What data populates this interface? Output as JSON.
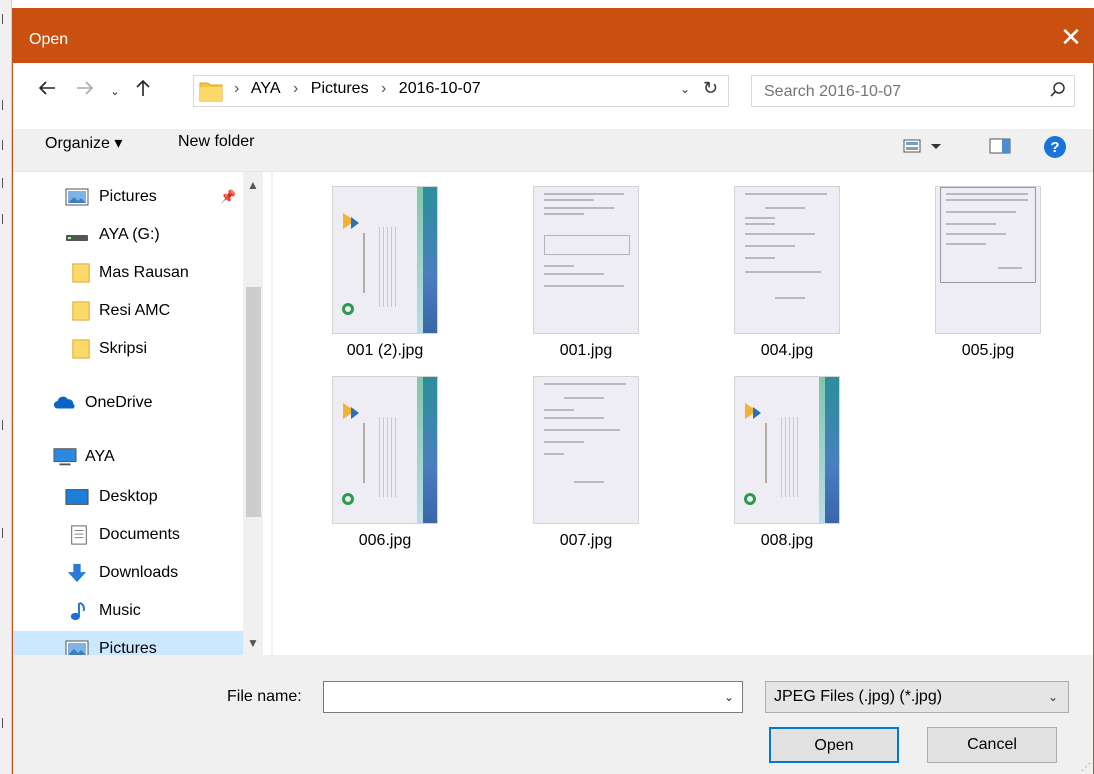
{
  "dialog": {
    "title": "Open",
    "close_glyph": "✕",
    "accent_color": "#c9500f"
  },
  "nav": {
    "back_icon": "back-arrow-icon",
    "forward_icon": "forward-arrow-icon",
    "recent_icon": "chevron-down-icon",
    "up_icon": "up-arrow-icon",
    "breadcrumbs": [
      "AYA",
      "Pictures",
      "2016-10-07"
    ],
    "search_placeholder": "Search 2016-10-07"
  },
  "toolbar": {
    "organize_label": "Organize ▾",
    "new_folder_label": "New folder",
    "help_glyph": "?"
  },
  "sidebar": {
    "items": [
      {
        "label": "Pictures",
        "icon": "pictures-folder-icon",
        "pinned": true
      },
      {
        "label": "AYA (G:)",
        "icon": "drive-icon"
      },
      {
        "label": "Mas Rausan",
        "icon": "folder-icon"
      },
      {
        "label": "Resi AMC",
        "icon": "folder-icon"
      },
      {
        "label": "Skripsi",
        "icon": "folder-icon"
      },
      {
        "label": "OneDrive",
        "icon": "onedrive-cloud-icon"
      },
      {
        "label": "AYA",
        "icon": "computer-icon"
      },
      {
        "label": "Desktop",
        "icon": "desktop-icon"
      },
      {
        "label": "Documents",
        "icon": "documents-icon"
      },
      {
        "label": "Downloads",
        "icon": "downloads-icon"
      },
      {
        "label": "Music",
        "icon": "music-icon"
      },
      {
        "label": "Pictures",
        "icon": "pictures-folder-icon",
        "selected": true
      }
    ]
  },
  "files": [
    {
      "name": "001 (2).jpg",
      "kind": "certificate"
    },
    {
      "name": "001.jpg",
      "kind": "document"
    },
    {
      "name": "004.jpg",
      "kind": "document"
    },
    {
      "name": "005.jpg",
      "kind": "document"
    },
    {
      "name": "006.jpg",
      "kind": "certificate"
    },
    {
      "name": "007.jpg",
      "kind": "document"
    },
    {
      "name": "008.jpg",
      "kind": "certificate"
    }
  ],
  "bottom": {
    "file_name_label": "File name:",
    "file_name_value": "",
    "file_type_value": "JPEG Files (.jpg) (*.jpg)",
    "open_label": "Open",
    "cancel_label": "Cancel"
  }
}
